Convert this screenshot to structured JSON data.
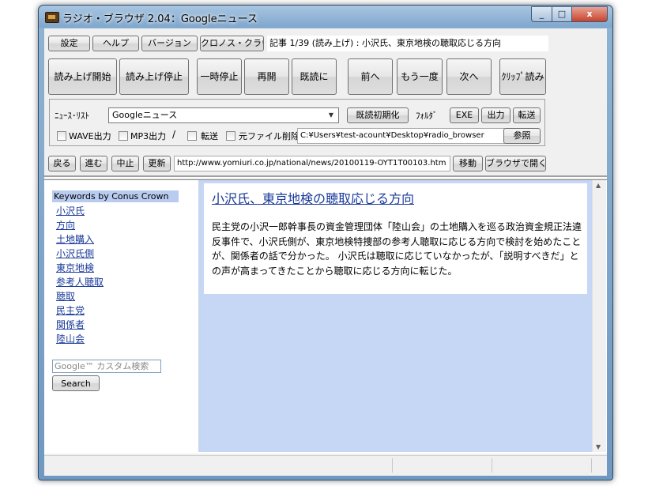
{
  "window": {
    "title": "ラジオ・ブラウザ 2.04：Googleニュース",
    "minimize": "_",
    "maximize": "□",
    "close": "x"
  },
  "menu": {
    "settings": "設定",
    "help": "ヘルプ",
    "version": "バージョン",
    "chronos": "クロノス・クラウン"
  },
  "article_label": "記事 1/39 (読み上げ) : 小沢氏、東京地検の聴取応じる方向",
  "controls": {
    "start_reading": "読み上げ開始",
    "stop_reading": "読み上げ停止",
    "pause": "一時停止",
    "resume": "再開",
    "mark_read": "既読に",
    "prev": "前へ",
    "again": "もう一度",
    "next": "次へ",
    "clip_read": "ｸﾘｯﾌﾟ読み"
  },
  "options": {
    "news_list_label": "ﾆｭｰｽ･ﾘｽﾄ",
    "news_list_value": "Googleニュース",
    "reset_read": "既読初期化",
    "folder_label": "ﾌｫﾙﾀﾞ",
    "exe": "EXE",
    "output": "出力",
    "transfer": "転送",
    "wave_output": "WAVE出力",
    "mp3_output": "MP3出力",
    "slash": "/",
    "transfer_check": "転送",
    "delete_original": "元ファイル削除",
    "folder_path": "C:¥Users¥test-acount¥Desktop¥radio_browser",
    "browse": "参照"
  },
  "nav": {
    "back": "戻る",
    "forward": "進む",
    "stop": "中止",
    "refresh": "更新",
    "url": "http://www.yomiuri.co.jp/national/news/20100119-OYT1T00103.htm",
    "go": "移動",
    "open_browser": "ブラウザで開く"
  },
  "sidebar": {
    "heading": "Keywords by Conus Crown",
    "keywords": [
      "小沢氏",
      "方向",
      "土地購入",
      "小沢氏側",
      "東京地検",
      "参考人聴取",
      "聴取",
      "民主党",
      "関係者",
      "陸山会"
    ],
    "search_placeholder": "Google™ カスタム検索",
    "search_button": "Search"
  },
  "article": {
    "title": "小沢氏、東京地検の聴取応じる方向",
    "body": "民主党の小沢一郎幹事長の資金管理団体「陸山会」の土地購入を巡る政治資金規正法違反事件で、小沢氏側が、東京地検特捜部の参考人聴取に応じる方向で検討を始めたことが、関係者の話で分かった。 小沢氏は聴取に応じていなかったが、「説明すべきだ」との声が高まってきたことから聴取に応じる方向に転じた。"
  }
}
